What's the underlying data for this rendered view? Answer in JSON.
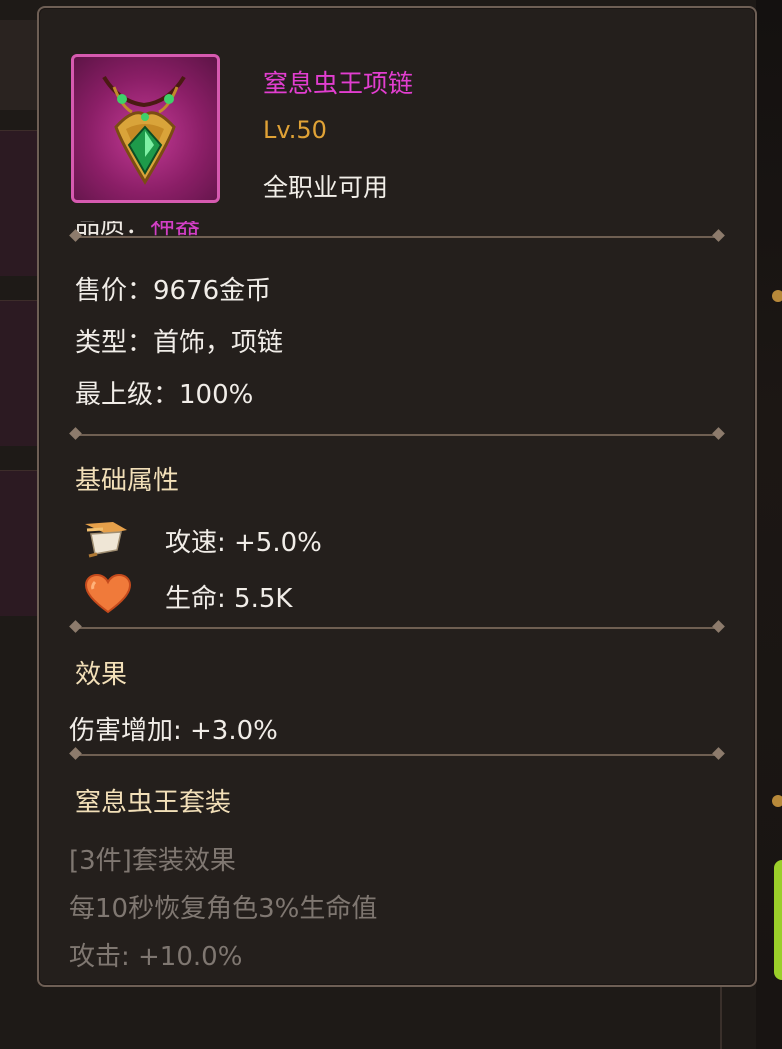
{
  "item": {
    "name": "窒息虫王项链",
    "level": "Lv.50",
    "class_restriction": "全职业可用",
    "quality_label": "品质：",
    "quality_value": "神器",
    "sell_price": "售价：9676金币",
    "type": "类型：首饰，项链",
    "max_upgrade": "最上级：100%",
    "icon": "necklace-icon"
  },
  "base_stats": {
    "title": "基础属性",
    "items": [
      {
        "icon": "attack-speed-icon",
        "text": "攻速: +5.0%"
      },
      {
        "icon": "heart-icon",
        "text": "生命: 5.5K"
      }
    ]
  },
  "effect": {
    "title": "效果",
    "text": "伤害增加: +3.0%"
  },
  "set": {
    "title": "窒息虫王套装",
    "bonus_header": "[3件]套装效果",
    "lines": [
      "每10秒恢复角色3%生命值",
      "攻击: +10.0%"
    ]
  },
  "colors": {
    "name": "#e23ed0",
    "level": "#e0a236",
    "section_title": "#f2dfb8",
    "inactive": "#7f7771",
    "panel_bg": "#241f1c"
  }
}
